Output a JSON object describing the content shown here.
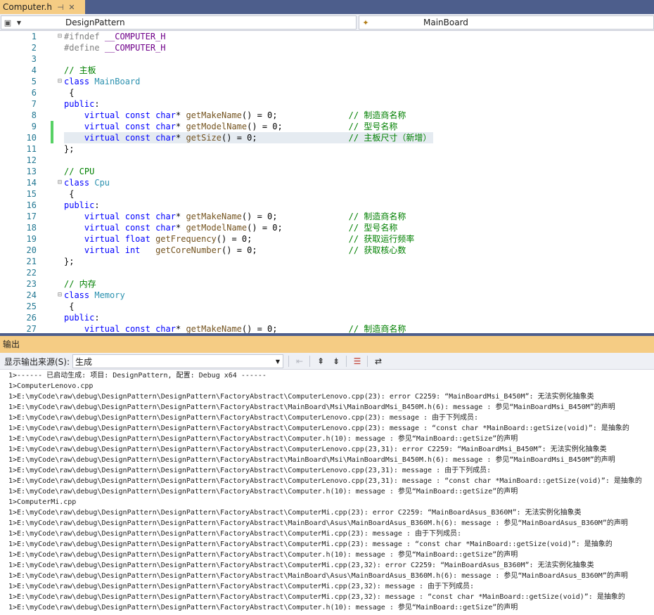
{
  "tab": {
    "title": "Computer.h",
    "pin_glyph": "⊣",
    "close_glyph": "✕"
  },
  "nav": {
    "project": "DesignPattern",
    "symbol": "MainBoard"
  },
  "editor": {
    "lines": [
      {
        "n": "1",
        "fold": "⊟",
        "gutter": "",
        "text": "#ifndef __COMPUTER_H"
      },
      {
        "n": "2",
        "fold": "",
        "gutter": "",
        "text": "#define __COMPUTER_H"
      },
      {
        "n": "3",
        "fold": "",
        "gutter": "",
        "text": ""
      },
      {
        "n": "4",
        "fold": "",
        "gutter": "",
        "text": "// 主板"
      },
      {
        "n": "5",
        "fold": "⊟",
        "gutter": "",
        "text": "class MainBoard"
      },
      {
        "n": "6",
        "fold": "",
        "gutter": "",
        "text": " {"
      },
      {
        "n": "7",
        "fold": "",
        "gutter": "",
        "text": "public:"
      },
      {
        "n": "8",
        "fold": "",
        "gutter": "",
        "text": "    virtual const char* getMakeName() = 0;              // 制造商名称"
      },
      {
        "n": "9",
        "fold": "",
        "gutter": "changed",
        "text": "    virtual const char* getModelName() = 0;             // 型号名称"
      },
      {
        "n": "10",
        "fold": "",
        "gutter": "changed",
        "text": "    virtual const char* getSize() = 0;                  // 主板尺寸（新增）",
        "highlight": true
      },
      {
        "n": "11",
        "fold": "",
        "gutter": "",
        "text": "};"
      },
      {
        "n": "12",
        "fold": "",
        "gutter": "",
        "text": ""
      },
      {
        "n": "13",
        "fold": "",
        "gutter": "",
        "text": "// CPU"
      },
      {
        "n": "14",
        "fold": "⊟",
        "gutter": "",
        "text": "class Cpu"
      },
      {
        "n": "15",
        "fold": "",
        "gutter": "",
        "text": " {"
      },
      {
        "n": "16",
        "fold": "",
        "gutter": "",
        "text": "public:"
      },
      {
        "n": "17",
        "fold": "",
        "gutter": "",
        "text": "    virtual const char* getMakeName() = 0;              // 制造商名称"
      },
      {
        "n": "18",
        "fold": "",
        "gutter": "",
        "text": "    virtual const char* getModelName() = 0;             // 型号名称"
      },
      {
        "n": "19",
        "fold": "",
        "gutter": "",
        "text": "    virtual float getFrequency() = 0;                   // 获取运行频率"
      },
      {
        "n": "20",
        "fold": "",
        "gutter": "",
        "text": "    virtual int   getCoreNumber() = 0;                  // 获取核心数"
      },
      {
        "n": "21",
        "fold": "",
        "gutter": "",
        "text": "};"
      },
      {
        "n": "22",
        "fold": "",
        "gutter": "",
        "text": ""
      },
      {
        "n": "23",
        "fold": "",
        "gutter": "",
        "text": "// 内存"
      },
      {
        "n": "24",
        "fold": "⊟",
        "gutter": "",
        "text": "class Memory"
      },
      {
        "n": "25",
        "fold": "",
        "gutter": "",
        "text": " {"
      },
      {
        "n": "26",
        "fold": "",
        "gutter": "",
        "text": "public:"
      },
      {
        "n": "27",
        "fold": "",
        "gutter": "",
        "text": "    virtual const char* getMakeName() = 0;              // 制造商名称"
      }
    ]
  },
  "output": {
    "title": "输出",
    "source_label": "显示输出来源(S):",
    "source_value": "生成",
    "lines": [
      "1>------ 已启动生成: 项目: DesignPattern, 配置: Debug x64 ------",
      "1>ComputerLenovo.cpp",
      "1>E:\\myCode\\raw\\debug\\DesignPattern\\DesignPattern\\FactoryAbstract\\ComputerLenovo.cpp(23): error C2259: “MainBoardMsi_B450M”: 无法实例化抽象类",
      "1>E:\\myCode\\raw\\debug\\DesignPattern\\DesignPattern\\FactoryAbstract\\MainBoard\\Msi\\MainBoardMsi_B450M.h(6): message : 参见“MainBoardMsi_B450M”的声明",
      "1>E:\\myCode\\raw\\debug\\DesignPattern\\DesignPattern\\FactoryAbstract\\ComputerLenovo.cpp(23): message : 由于下列成员:",
      "1>E:\\myCode\\raw\\debug\\DesignPattern\\DesignPattern\\FactoryAbstract\\ComputerLenovo.cpp(23): message : “const char *MainBoard::getSize(void)”: 是抽象的",
      "1>E:\\myCode\\raw\\debug\\DesignPattern\\DesignPattern\\FactoryAbstract\\Computer.h(10): message : 参见“MainBoard::getSize”的声明",
      "1>E:\\myCode\\raw\\debug\\DesignPattern\\DesignPattern\\FactoryAbstract\\ComputerLenovo.cpp(23,31): error C2259: “MainBoardMsi_B450M”: 无法实例化抽象类",
      "1>E:\\myCode\\raw\\debug\\DesignPattern\\DesignPattern\\FactoryAbstract\\MainBoard\\Msi\\MainBoardMsi_B450M.h(6): message : 参见“MainBoardMsi_B450M”的声明",
      "1>E:\\myCode\\raw\\debug\\DesignPattern\\DesignPattern\\FactoryAbstract\\ComputerLenovo.cpp(23,31): message : 由于下列成员:",
      "1>E:\\myCode\\raw\\debug\\DesignPattern\\DesignPattern\\FactoryAbstract\\ComputerLenovo.cpp(23,31): message : “const char *MainBoard::getSize(void)”: 是抽象的",
      "1>E:\\myCode\\raw\\debug\\DesignPattern\\DesignPattern\\FactoryAbstract\\Computer.h(10): message : 参见“MainBoard::getSize”的声明",
      "1>ComputerMi.cpp",
      "1>E:\\myCode\\raw\\debug\\DesignPattern\\DesignPattern\\FactoryAbstract\\ComputerMi.cpp(23): error C2259: “MainBoardAsus_B360M”: 无法实例化抽象类",
      "1>E:\\myCode\\raw\\debug\\DesignPattern\\DesignPattern\\FactoryAbstract\\MainBoard\\Asus\\MainBoardAsus_B360M.h(6): message : 参见“MainBoardAsus_B360M”的声明",
      "1>E:\\myCode\\raw\\debug\\DesignPattern\\DesignPattern\\FactoryAbstract\\ComputerMi.cpp(23): message : 由于下列成员:",
      "1>E:\\myCode\\raw\\debug\\DesignPattern\\DesignPattern\\FactoryAbstract\\ComputerMi.cpp(23): message : “const char *MainBoard::getSize(void)”: 是抽象的",
      "1>E:\\myCode\\raw\\debug\\DesignPattern\\DesignPattern\\FactoryAbstract\\Computer.h(10): message : 参见“MainBoard::getSize”的声明",
      "1>E:\\myCode\\raw\\debug\\DesignPattern\\DesignPattern\\FactoryAbstract\\ComputerMi.cpp(23,32): error C2259: “MainBoardAsus_B360M”: 无法实例化抽象类",
      "1>E:\\myCode\\raw\\debug\\DesignPattern\\DesignPattern\\FactoryAbstract\\MainBoard\\Asus\\MainBoardAsus_B360M.h(6): message : 参见“MainBoardAsus_B360M”的声明",
      "1>E:\\myCode\\raw\\debug\\DesignPattern\\DesignPattern\\FactoryAbstract\\ComputerMi.cpp(23,32): message : 由于下列成员:",
      "1>E:\\myCode\\raw\\debug\\DesignPattern\\DesignPattern\\FactoryAbstract\\ComputerMi.cpp(23,32): message : “const char *MainBoard::getSize(void)”: 是抽象的",
      "1>E:\\myCode\\raw\\debug\\DesignPattern\\DesignPattern\\FactoryAbstract\\Computer.h(10): message : 参见“MainBoard::getSize”的声明"
    ]
  },
  "colors": {
    "keyword": "#0000ff",
    "class_name": "#2b91af",
    "comment": "#008000",
    "function": "#74531f",
    "macro": "#6f008a",
    "preprocessor": "#808080",
    "text": "#000000"
  }
}
